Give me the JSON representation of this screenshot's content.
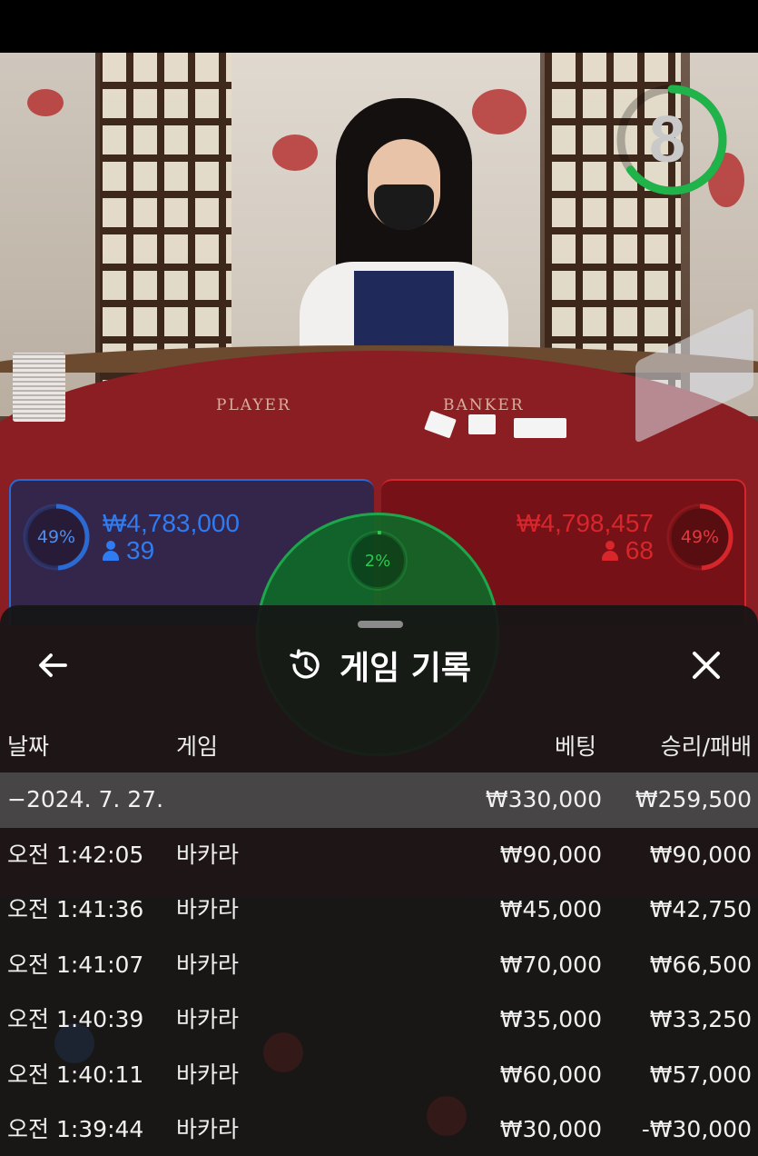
{
  "timer": {
    "value": "8",
    "progress": 0.65,
    "color": "#1fb34a"
  },
  "table": {
    "player_text": "PLAYER",
    "banker_text": "BANKER"
  },
  "player": {
    "percent": "49%",
    "amount": "₩4,783,000",
    "count": "39",
    "color": "#2a6ad2"
  },
  "banker": {
    "percent": "49%",
    "amount": "₩4,798,457",
    "count": "68",
    "color": "#d4262b"
  },
  "tie": {
    "percent": "2%",
    "color": "#2cc84f"
  },
  "history": {
    "title": "게임 기록",
    "icons": {
      "back": "back-arrow-icon",
      "history": "history-icon",
      "close": "close-icon"
    },
    "columns": {
      "date": "날짜",
      "game": "게임",
      "bet": "베팅",
      "result": "승리/패배"
    },
    "date_row": {
      "date": "−2024. 7. 27.",
      "bet": "₩330,000",
      "result": "₩259,500"
    },
    "rows": [
      {
        "time": "오전 1:42:05",
        "game": "바카라",
        "bet": "₩90,000",
        "result": "₩90,000"
      },
      {
        "time": "오전 1:41:36",
        "game": "바카라",
        "bet": "₩45,000",
        "result": "₩42,750"
      },
      {
        "time": "오전 1:41:07",
        "game": "바카라",
        "bet": "₩70,000",
        "result": "₩66,500"
      },
      {
        "time": "오전 1:40:39",
        "game": "바카라",
        "bet": "₩35,000",
        "result": "₩33,250"
      },
      {
        "time": "오전 1:40:11",
        "game": "바카라",
        "bet": "₩60,000",
        "result": "₩57,000"
      },
      {
        "time": "오전 1:39:44",
        "game": "바카라",
        "bet": "₩30,000",
        "result": "-₩30,000"
      }
    ]
  }
}
